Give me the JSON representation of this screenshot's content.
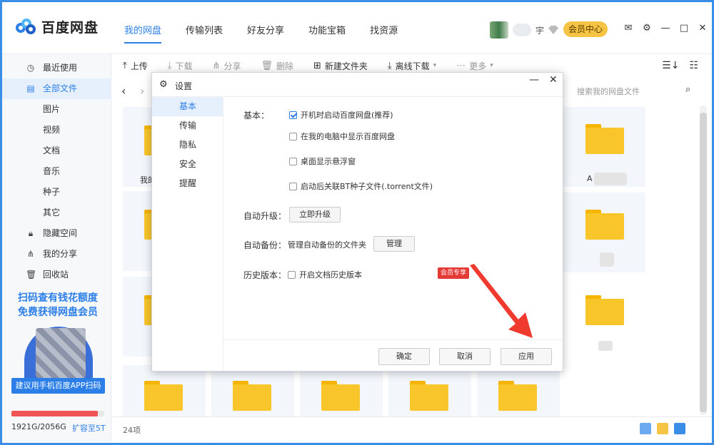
{
  "app": {
    "name": "百度网盘"
  },
  "nav": {
    "tabs": [
      "我的网盘",
      "传输列表",
      "好友分享",
      "功能宝箱",
      "找资源"
    ],
    "active": 0
  },
  "user": {
    "name_suffix": "宇",
    "member_center": "会员中心"
  },
  "sidebar": {
    "items": [
      {
        "label": "最近使用",
        "icon": "clock-icon"
      },
      {
        "label": "全部文件",
        "icon": "file-icon"
      },
      {
        "label": "图片"
      },
      {
        "label": "视频"
      },
      {
        "label": "文档"
      },
      {
        "label": "音乐"
      },
      {
        "label": "种子"
      },
      {
        "label": "其它"
      },
      {
        "label": "隐藏空间",
        "icon": "lock-icon"
      },
      {
        "label": "我的分享",
        "icon": "share-icon"
      },
      {
        "label": "回收站",
        "icon": "trash-icon"
      }
    ],
    "promo": {
      "line1": "扫码查有钱花额度",
      "line2": "免费获得网盘会员",
      "button": "建议用手机百度APP扫码"
    },
    "storage": {
      "used": "1921G",
      "total": "2056G",
      "text": "1921G/2056G",
      "expand": "扩容至5T",
      "fill_fraction": 0.934
    }
  },
  "toolbar": {
    "upload": "上传",
    "download": "下载",
    "share": "分享",
    "delete": "删除",
    "new_folder": "新建文件夹",
    "offline_download": "离线下载",
    "more": "更多"
  },
  "search": {
    "placeholder": "搜索我的网盘文件"
  },
  "grid": {
    "labels": [
      "我的",
      "A"
    ]
  },
  "status": {
    "count": "24项"
  },
  "settings": {
    "title": "设置",
    "tabs": [
      "基本",
      "传输",
      "隐私",
      "安全",
      "提醒"
    ],
    "basic_label": "基本：",
    "options": [
      {
        "label": "开机时启动百度网盘(推荐)",
        "checked": true
      },
      {
        "label": "在我的电脑中显示百度网盘",
        "checked": false
      },
      {
        "label": "桌面显示悬浮窗",
        "checked": false
      },
      {
        "label": "启动后关联BT种子文件(.torrent文件)",
        "checked": false
      }
    ],
    "auto_upgrade_label": "自动升级：",
    "upgrade_button": "立即升级",
    "auto_backup_label": "自动备份：",
    "backup_desc": "管理自动备份的文件夹",
    "manage_button": "管理",
    "history_label": "历史版本：",
    "history_option": "开启文档历史版本",
    "vip_tag": "会员专享",
    "ok": "确定",
    "cancel": "取消",
    "apply": "应用"
  },
  "colors": {
    "accent": "#2d7fe8",
    "folder": "#f8c52b",
    "vip_tag": "#e53935",
    "arrow": "#f03a2e"
  }
}
